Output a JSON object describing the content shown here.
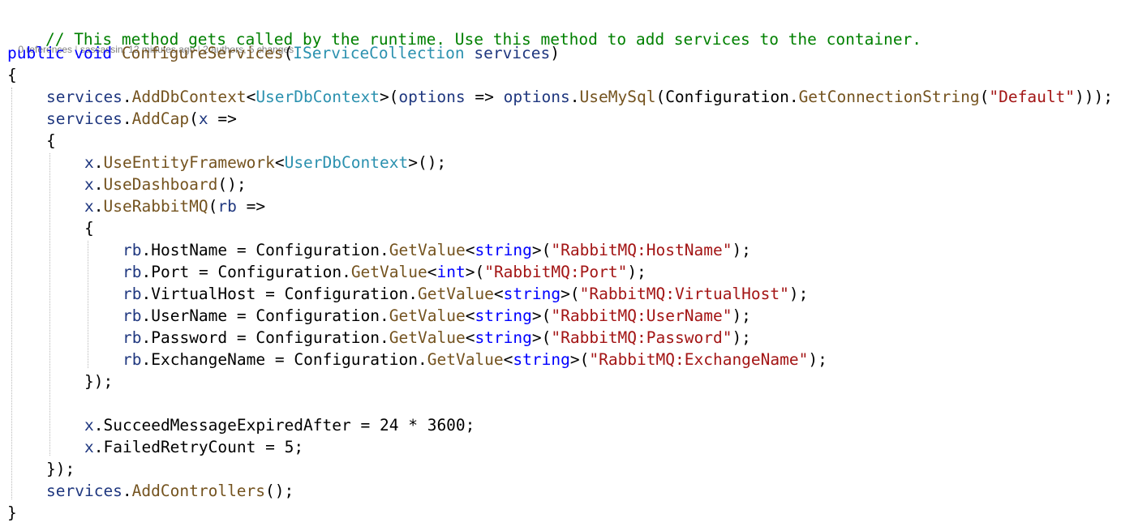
{
  "comment": "// This method gets called by the runtime. Use this method to add services to the container.",
  "codelens": {
    "references": "0 references",
    "author": "sassassin, 12 minutes ago",
    "changes": "2 authors, 5 changes",
    "separator": " | "
  },
  "tokens": {
    "kw_public": "public",
    "kw_void": "void",
    "kw_string": "string",
    "kw_int": "int",
    "m_configure_services": "ConfigureServices",
    "t_iservice_collection": "IServiceCollection",
    "v_services": "services",
    "m_add_db_context": "AddDbContext",
    "t_user_db_context": "UserDbContext",
    "v_options": "options",
    "m_use_my_sql": "UseMySql",
    "n_configuration": "Configuration",
    "m_get_connection_string": "GetConnectionString",
    "s_default": "\"Default\"",
    "m_add_cap": "AddCap",
    "v_x": "x",
    "m_use_entity_framework": "UseEntityFramework",
    "m_use_dashboard": "UseDashboard",
    "m_use_rabbit_mq": "UseRabbitMQ",
    "v_rb": "rb",
    "n_host_name": "HostName",
    "n_port": "Port",
    "n_virtual_host": "VirtualHost",
    "n_user_name": "UserName",
    "n_password": "Password",
    "n_exchange_name": "ExchangeName",
    "m_get_value": "GetValue",
    "s_host_name": "\"RabbitMQ:HostName\"",
    "s_port": "\"RabbitMQ:Port\"",
    "s_virtual_host": "\"RabbitMQ:VirtualHost\"",
    "s_user_name": "\"RabbitMQ:UserName\"",
    "s_password": "\"RabbitMQ:Password\"",
    "s_exchange_name": "\"RabbitMQ:ExchangeName\"",
    "n_succeed_expired": "SucceedMessageExpiredAfter",
    "n_failed_retry": "FailedRetryCount",
    "num_24": "24",
    "num_3600": "3600",
    "num_5": "5",
    "m_add_controllers": "AddControllers",
    "p_open_brace": "{",
    "p_close_brace": "}",
    "p_close_lambda": "});",
    "p_dot": ".",
    "p_space": " ",
    "p_open_paren": "(",
    "p_close_paren": ")",
    "p_lt": "<",
    "p_gt": ">",
    "p_lambda": " =>",
    "p_lambda_mid": " => ",
    "p_assign": " = ",
    "p_times": " * ",
    "p_call_end": "();",
    "p_semi_end": ");",
    "p_gt_paren": ">(",
    "p_triple_close": ")));"
  }
}
